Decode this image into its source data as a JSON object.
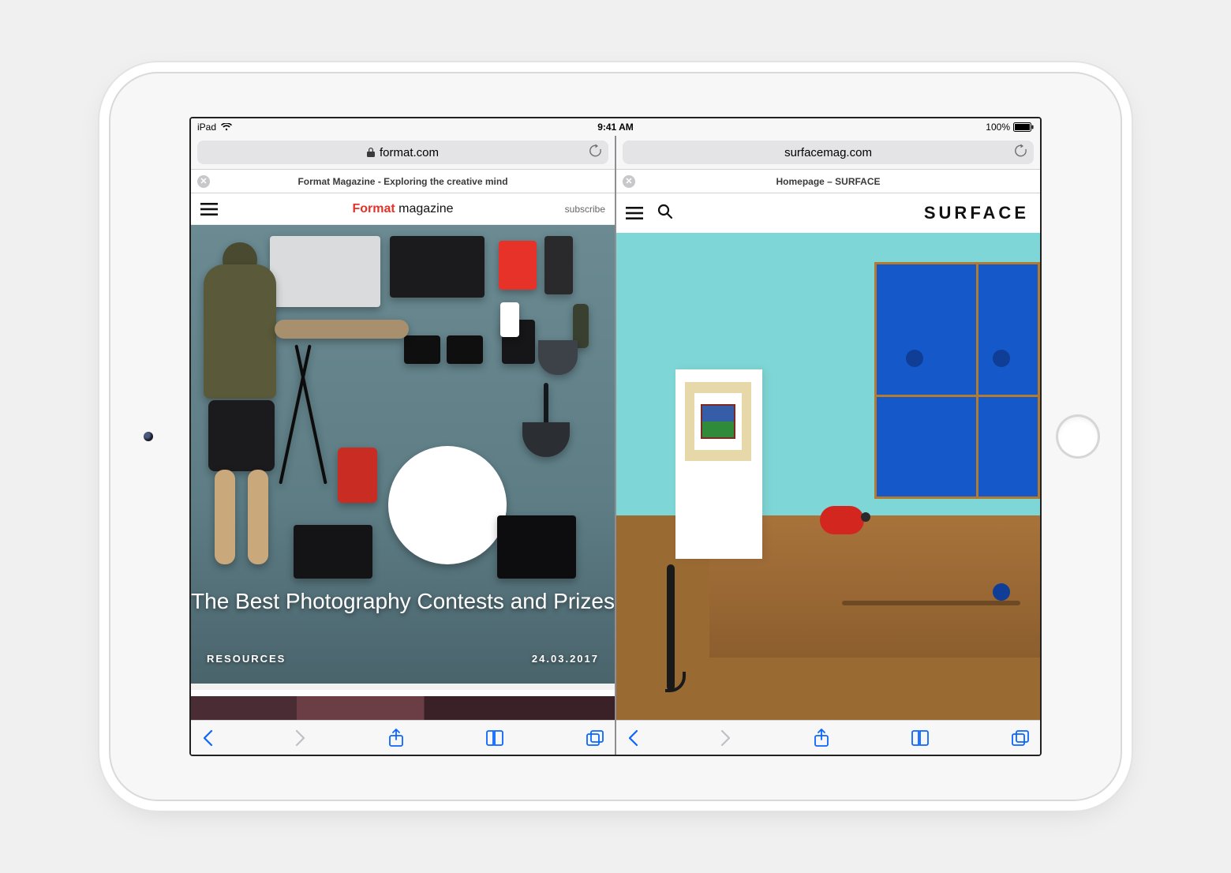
{
  "status": {
    "carrier": "iPad",
    "time": "9:41 AM",
    "battery_pct": "100%"
  },
  "panes": [
    {
      "url": "format.com",
      "secure": true,
      "page_title": "Format Magazine - Exploring the creative mind",
      "site": {
        "brand_primary": "Format",
        "brand_secondary": "magazine",
        "subscribe_label": "subscribe",
        "hero_title": "The Best Photography Contests and Prizes",
        "hero_category": "RESOURCES",
        "hero_date": "24.03.2017"
      }
    },
    {
      "url": "surfacemag.com",
      "secure": false,
      "page_title": "Homepage – SURFACE",
      "site": {
        "brand": "SURFACE"
      }
    }
  ]
}
